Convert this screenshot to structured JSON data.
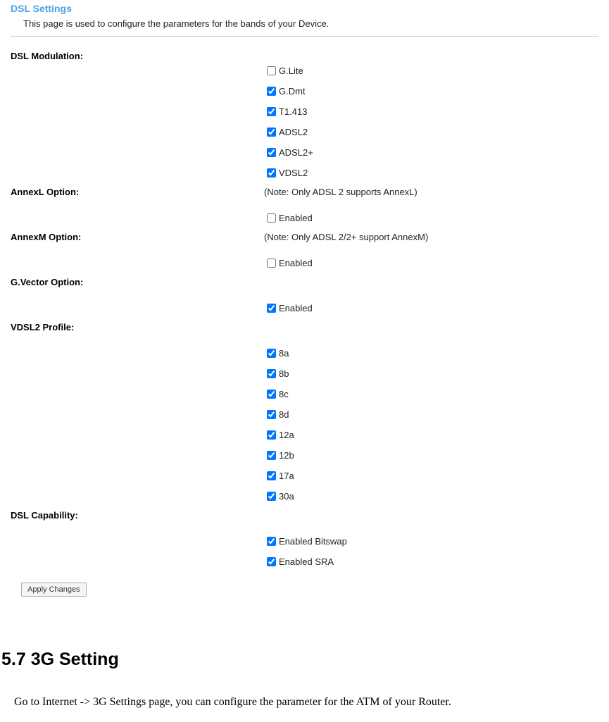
{
  "page_title": "DSL Settings",
  "page_desc": "This page is used to configure the parameters for the bands of your Device.",
  "dsl_modulation": {
    "label": "DSL Modulation:",
    "options": [
      {
        "label": "G.Lite",
        "checked": false
      },
      {
        "label": "G.Dmt",
        "checked": true
      },
      {
        "label": "T1.413",
        "checked": true
      },
      {
        "label": "ADSL2",
        "checked": true
      },
      {
        "label": "ADSL2+",
        "checked": true
      },
      {
        "label": "VDSL2",
        "checked": true
      }
    ]
  },
  "annexl": {
    "label": "AnnexL Option:",
    "note": "(Note: Only ADSL 2 supports AnnexL)",
    "options": [
      {
        "label": "Enabled",
        "checked": false
      }
    ]
  },
  "annexm": {
    "label": "AnnexM Option:",
    "note": "(Note: Only ADSL 2/2+ support AnnexM)",
    "options": [
      {
        "label": "Enabled",
        "checked": false
      }
    ]
  },
  "gvector": {
    "label": "G.Vector Option:",
    "options": [
      {
        "label": "Enabled",
        "checked": true
      }
    ]
  },
  "vdsl2_profile": {
    "label": "VDSL2 Profile:",
    "options": [
      {
        "label": "8a",
        "checked": true
      },
      {
        "label": "8b",
        "checked": true
      },
      {
        "label": "8c",
        "checked": true
      },
      {
        "label": "8d",
        "checked": true
      },
      {
        "label": "12a",
        "checked": true
      },
      {
        "label": "12b",
        "checked": true
      },
      {
        "label": "17a",
        "checked": true
      },
      {
        "label": "30a",
        "checked": true
      }
    ]
  },
  "dsl_capability": {
    "label": "DSL Capability:",
    "options": [
      {
        "label": "Enabled Bitswap",
        "checked": true
      },
      {
        "label": "Enabled SRA",
        "checked": true
      }
    ]
  },
  "apply_button": "Apply Changes",
  "doc": {
    "heading": "5.7 3G Setting",
    "body": "Go to Internet -> 3G Settings page, you can configure the parameter for the ATM of your Router."
  }
}
